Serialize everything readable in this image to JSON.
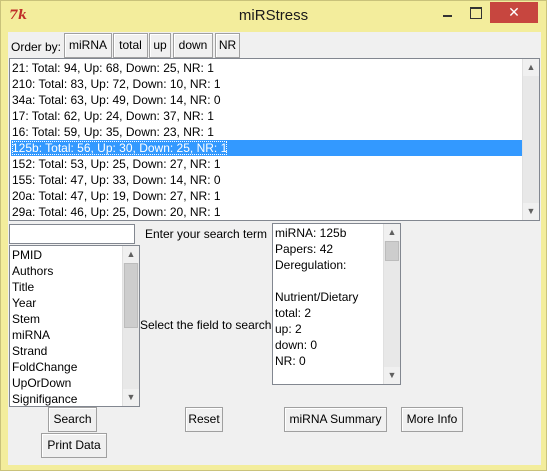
{
  "window": {
    "title": "miRStress",
    "icon_glyph": "7k",
    "close_glyph": "✕"
  },
  "order_bar": {
    "label": "Order by:",
    "buttons": [
      "miRNA",
      "total",
      "up",
      "down",
      "NR"
    ]
  },
  "results": {
    "items": [
      "21: Total: 94, Up: 68, Down: 25, NR: 1",
      "210: Total: 83, Up: 72, Down: 10, NR: 1",
      "34a: Total: 63, Up: 49, Down: 14, NR: 0",
      "17: Total: 62, Up: 24, Down: 37, NR: 1",
      "16: Total: 59, Up: 35, Down: 23, NR: 1",
      "125b: Total: 56, Up: 30, Down: 25, NR: 1",
      "152: Total: 53, Up: 25, Down: 27, NR: 1",
      "155: Total: 47, Up: 33, Down: 14, NR: 0",
      "20a: Total: 47, Up: 19, Down: 27, NR: 1",
      "29a: Total: 46, Up: 25, Down: 20, NR: 1"
    ],
    "selected_index": 5
  },
  "search": {
    "value": "",
    "prompt_label": "Enter your search term",
    "field_label": "Select the field to search",
    "fields": [
      "PMID",
      "Authors",
      "Title",
      "Year",
      "Stem",
      "miRNA",
      "Strand",
      "FoldChange",
      "UpOrDown",
      "Signifigance"
    ]
  },
  "details": {
    "lines": [
      "miRNA: 125b",
      "Papers: 42",
      "Deregulation:",
      "",
      "Nutrient/Dietary",
      "total: 2",
      "up: 2",
      "down: 0",
      "NR: 0"
    ]
  },
  "actions": {
    "search": "Search",
    "reset": "Reset",
    "summary": "miRNA Summary",
    "more_info": "More Info",
    "print": "Print Data"
  },
  "colors": {
    "title_bar": "#f3ed9c",
    "selection": "#3399ff",
    "close_button": "#c7463f"
  }
}
